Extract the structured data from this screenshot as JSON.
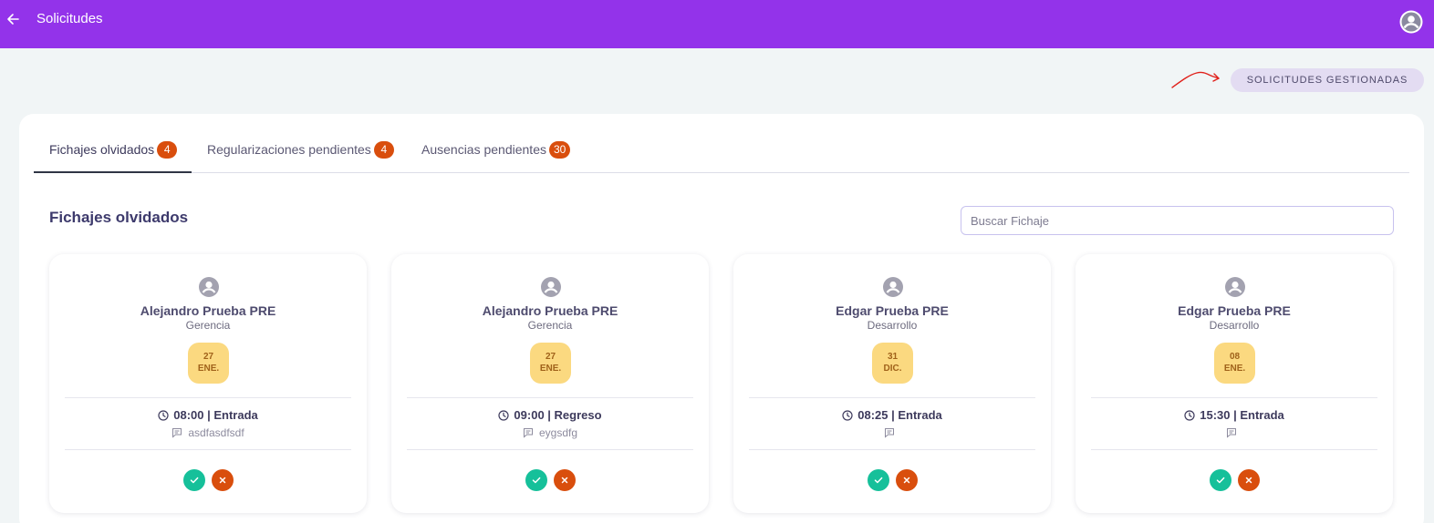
{
  "header": {
    "title": "Solicitudes"
  },
  "actions": {
    "managed_label": "SOLICITUDES GESTIONADAS"
  },
  "tabs": [
    {
      "label": "Fichajes olvidados",
      "count": "4"
    },
    {
      "label": "Regularizaciones pendientes",
      "count": "4"
    },
    {
      "label": "Ausencias pendientes",
      "count": "30"
    }
  ],
  "section": {
    "title": "Fichajes olvidados"
  },
  "search": {
    "placeholder": "Buscar Fichaje",
    "value": ""
  },
  "cards": [
    {
      "name": "Alejandro Prueba PRE",
      "department": "Gerencia",
      "day": "27",
      "month": "ENE.",
      "time": "08:00 | Entrada",
      "comment": "asdfasdfsdf"
    },
    {
      "name": "Alejandro Prueba PRE",
      "department": "Gerencia",
      "day": "27",
      "month": "ENE.",
      "time": "09:00 | Regreso",
      "comment": "eygsdfg"
    },
    {
      "name": "Edgar Prueba PRE",
      "department": "Desarrollo",
      "day": "31",
      "month": "DIC.",
      "time": "08:25 | Entrada",
      "comment": ""
    },
    {
      "name": "Edgar Prueba PRE",
      "department": "Desarrollo",
      "day": "08",
      "month": "ENE.",
      "time": "15:30 | Entrada",
      "comment": ""
    }
  ],
  "icons": {
    "back": "arrow-left-icon",
    "avatar": "account-circle-icon",
    "user": "account-circle-icon",
    "time": "clock-icon",
    "comment": "comment-icon",
    "approve": "check-icon",
    "reject": "close-icon"
  },
  "colors": {
    "header": "#9333ea",
    "badge": "#d94e0d",
    "approve": "#16c09a",
    "reject": "#d94e0d",
    "date_chip": "#fbd980",
    "annotation_arrow": "#e0201a"
  }
}
